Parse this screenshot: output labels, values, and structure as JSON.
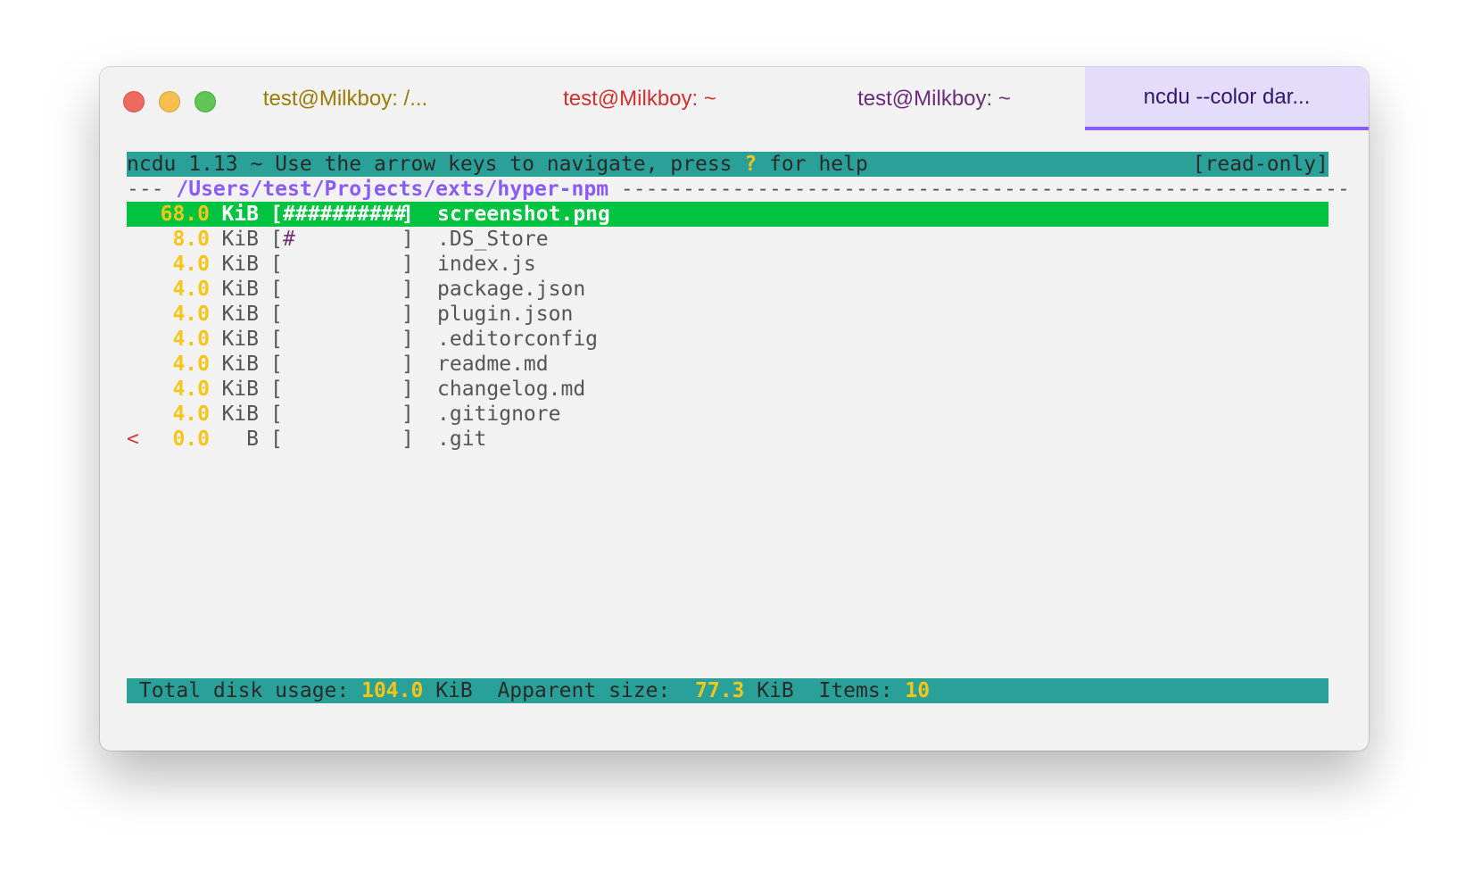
{
  "window": {
    "tabs": [
      {
        "label": "test@Milkboy: /...",
        "color": "#9a7b00",
        "active": false
      },
      {
        "label": "test@Milkboy: ~",
        "color": "#d0312d",
        "active": false
      },
      {
        "label": "test@Milkboy: ~",
        "color": "#6b2a7a",
        "active": false
      },
      {
        "label": "ncdu --color dar...",
        "color": "#2a1a6e",
        "active": true
      }
    ],
    "active_tab_accent": "#8a5cf6"
  },
  "header": {
    "prefix": "ncdu 1.13 ~ Use the arrow keys to navigate, press ",
    "help_key": "?",
    "suffix": " for help",
    "mode": "[read-only]"
  },
  "path": {
    "lead": "--- ",
    "value": "/Users/test/Projects/exts/hyper-npm",
    "trail": " -----------------------------------------------------------"
  },
  "entries": [
    {
      "marker": "",
      "size": "68.0",
      "unit": "KiB",
      "bar": "##########",
      "name": "screenshot.png",
      "selected": true
    },
    {
      "marker": "",
      "size": "8.0",
      "unit": "KiB",
      "bar": "#",
      "name": ".DS_Store",
      "selected": false
    },
    {
      "marker": "",
      "size": "4.0",
      "unit": "KiB",
      "bar": "",
      "name": "index.js",
      "selected": false
    },
    {
      "marker": "",
      "size": "4.0",
      "unit": "KiB",
      "bar": "",
      "name": "package.json",
      "selected": false
    },
    {
      "marker": "",
      "size": "4.0",
      "unit": "KiB",
      "bar": "",
      "name": "plugin.json",
      "selected": false
    },
    {
      "marker": "",
      "size": "4.0",
      "unit": "KiB",
      "bar": "",
      "name": ".editorconfig",
      "selected": false
    },
    {
      "marker": "",
      "size": "4.0",
      "unit": "KiB",
      "bar": "",
      "name": "readme.md",
      "selected": false
    },
    {
      "marker": "",
      "size": "4.0",
      "unit": "KiB",
      "bar": "",
      "name": "changelog.md",
      "selected": false
    },
    {
      "marker": "",
      "size": "4.0",
      "unit": "KiB",
      "bar": "",
      "name": ".gitignore",
      "selected": false
    },
    {
      "marker": "<",
      "size": "0.0",
      "unit": "B",
      "bar": "",
      "name": ".git",
      "selected": false
    }
  ],
  "footer": {
    "total_label": " Total disk usage: ",
    "total_value": "104.0",
    "total_unit": " KiB",
    "apparent_label": "  Apparent size:  ",
    "apparent_value": "77.3",
    "apparent_unit": " KiB",
    "items_label": "  Items: ",
    "items_value": "10"
  },
  "colors": {
    "header_bg": "#2aa198",
    "selected_bg": "#00c43f",
    "size": "#f3c000",
    "path": "#8a5cf6",
    "marker": "#d33a3a"
  }
}
